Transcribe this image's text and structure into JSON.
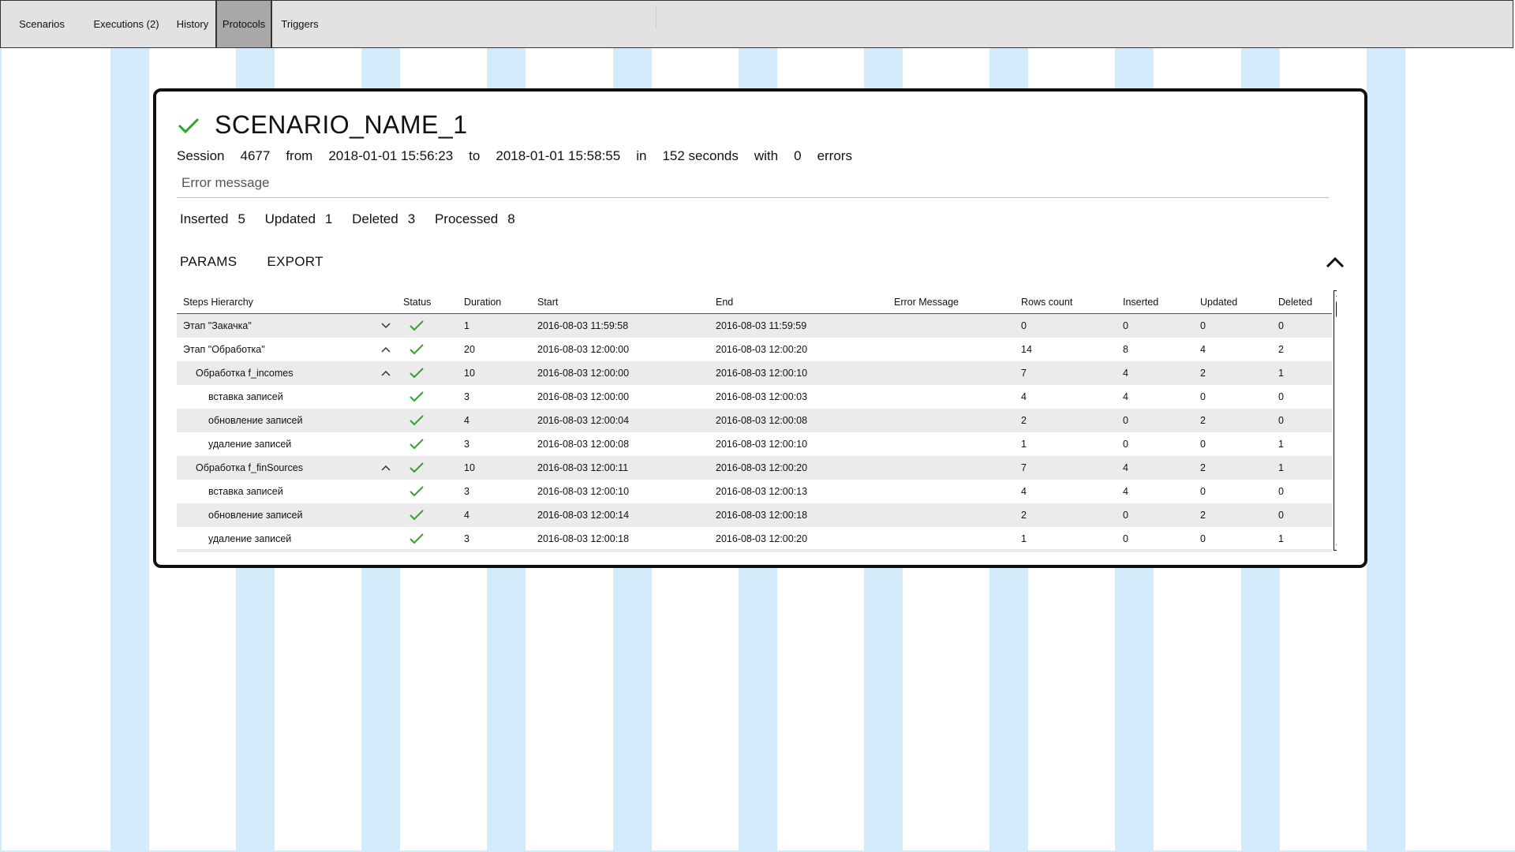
{
  "tabs": [
    {
      "label": "Scenarios",
      "active": false
    },
    {
      "label": "Executions (2)",
      "active": false
    },
    {
      "label": "History",
      "active": false
    },
    {
      "label": "Protocols",
      "active": true
    },
    {
      "label": "Triggers",
      "active": false
    }
  ],
  "scenario": {
    "status_icon": "check-icon",
    "name": "SCENARIO_NAME_1",
    "session_label": "Session",
    "session_id": "4677",
    "from_label": "from",
    "from": "2018-01-01 15:56:23",
    "to_label": "to",
    "to": "2018-01-01 15:58:55",
    "in_label": "in",
    "duration": "152 seconds",
    "with_label": "with",
    "errors_count": "0",
    "errors_label": "errors",
    "error_message_placeholder": "Error message"
  },
  "counts": {
    "inserted_label": "Inserted",
    "inserted": "5",
    "updated_label": "Updated",
    "updated": "1",
    "deleted_label": "Deleted",
    "deleted": "3",
    "processed_label": "Processed",
    "processed": "8"
  },
  "actions": {
    "params_label": "PARAMS",
    "export_label": "EXPORT"
  },
  "table": {
    "headers": {
      "steps": "Steps Hierarchy",
      "status": "Status",
      "duration": "Duration",
      "start": "Start",
      "end": "End",
      "error": "Error Message",
      "rows": "Rows count",
      "inserted": "Inserted",
      "updated": "Updated",
      "deleted": "Deleted"
    },
    "rows": [
      {
        "name": "Этап \"Закачка\"",
        "level": 0,
        "caret": "down",
        "duration": "1",
        "start": "2016-08-03 11:59:58",
        "end": "2016-08-03 11:59:59",
        "rows": "0",
        "inserted": "0",
        "updated": "0",
        "deleted": "0"
      },
      {
        "name": "Этап \"Обработка\"",
        "level": 0,
        "caret": "up",
        "duration": "20",
        "start": "2016-08-03 12:00:00",
        "end": "2016-08-03 12:00:20",
        "rows": "14",
        "inserted": "8",
        "updated": "4",
        "deleted": "2"
      },
      {
        "name": "Обработка f_incomes",
        "level": 1,
        "caret": "up",
        "duration": "10",
        "start": "2016-08-03 12:00:00",
        "end": "2016-08-03 12:00:10",
        "rows": "7",
        "inserted": "4",
        "updated": "2",
        "deleted": "1"
      },
      {
        "name": "вставка записей",
        "level": 2,
        "caret": "",
        "duration": "3",
        "start": "2016-08-03 12:00:00",
        "end": "2016-08-03 12:00:03",
        "rows": "4",
        "inserted": "4",
        "updated": "0",
        "deleted": "0"
      },
      {
        "name": "обновление записей",
        "level": 2,
        "caret": "",
        "duration": "4",
        "start": "2016-08-03 12:00:04",
        "end": "2016-08-03 12:00:08",
        "rows": "2",
        "inserted": "0",
        "updated": "2",
        "deleted": "0"
      },
      {
        "name": "удаление записей",
        "level": 2,
        "caret": "",
        "duration": "3",
        "start": "2016-08-03 12:00:08",
        "end": "2016-08-03 12:00:10",
        "rows": "1",
        "inserted": "0",
        "updated": "0",
        "deleted": "1"
      },
      {
        "name": "Обработка f_finSources",
        "level": 1,
        "caret": "up",
        "duration": "10",
        "start": "2016-08-03 12:00:11",
        "end": "2016-08-03 12:00:20",
        "rows": "7",
        "inserted": "4",
        "updated": "2",
        "deleted": "1"
      },
      {
        "name": "вставка записей",
        "level": 2,
        "caret": "",
        "duration": "3",
        "start": "2016-08-03 12:00:10",
        "end": "2016-08-03 12:00:13",
        "rows": "4",
        "inserted": "4",
        "updated": "0",
        "deleted": "0"
      },
      {
        "name": "обновление записей",
        "level": 2,
        "caret": "",
        "duration": "4",
        "start": "2016-08-03 12:00:14",
        "end": "2016-08-03 12:00:18",
        "rows": "2",
        "inserted": "0",
        "updated": "2",
        "deleted": "0"
      },
      {
        "name": "удаление записей",
        "level": 2,
        "caret": "",
        "duration": "3",
        "start": "2016-08-03 12:00:18",
        "end": "2016-08-03 12:00:20",
        "rows": "1",
        "inserted": "0",
        "updated": "0",
        "deleted": "1"
      }
    ]
  },
  "colors": {
    "success": "#2aa62a",
    "stripe": "#d4ebfb",
    "tab_active": "#a8a8a8",
    "tabbar": "#e2e2e2",
    "row_alt": "#ebebeb"
  }
}
